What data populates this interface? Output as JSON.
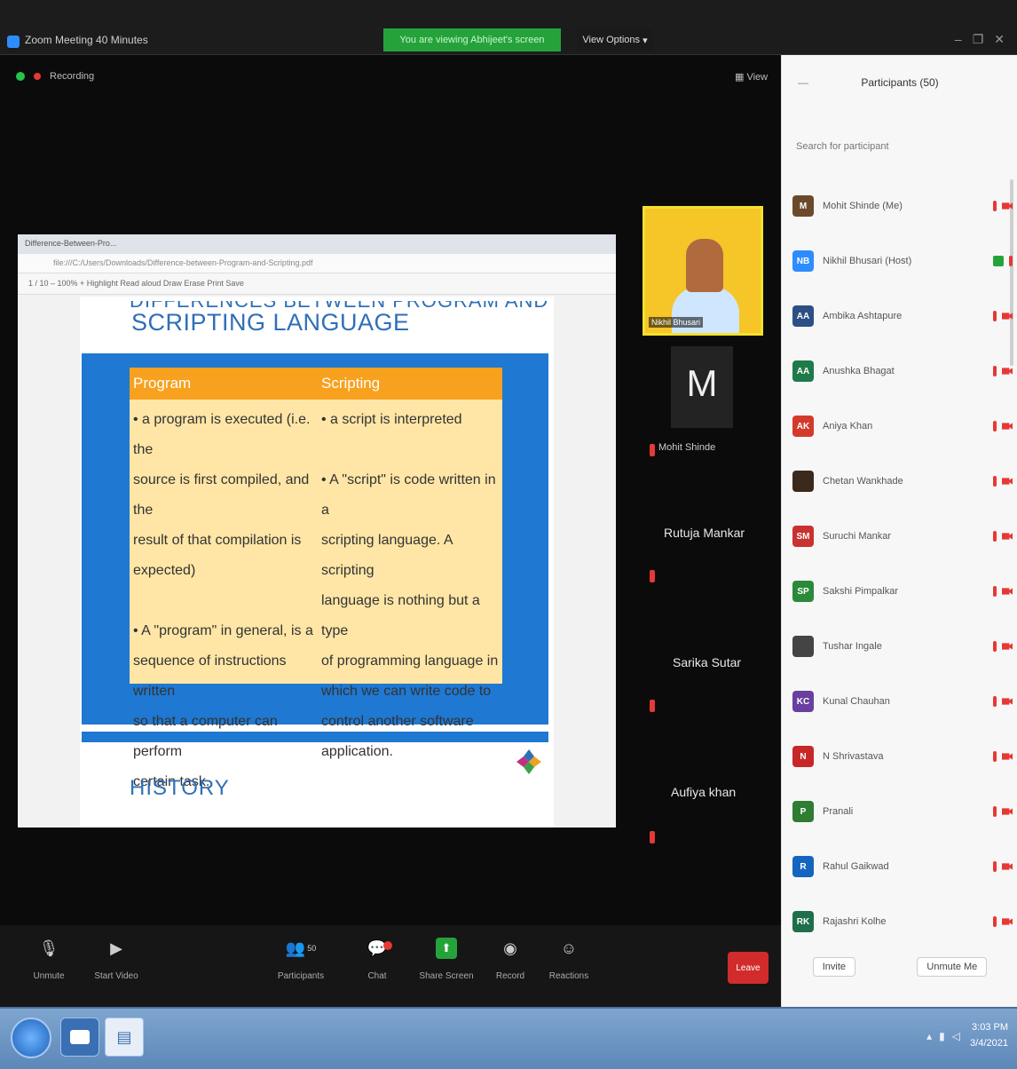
{
  "window": {
    "title": "Zoom Meeting 40 Minutes",
    "share_banner": "You are viewing Abhijeet's screen",
    "view_options": "View Options",
    "controls": [
      "–",
      "❐",
      "✕"
    ]
  },
  "meeting": {
    "recording_label": "Recording",
    "view_button": "View"
  },
  "browser": {
    "tab_label": "Difference-Between-Pro...",
    "address": "file:///C:/Users/Downloads/Difference-between-Program-and-Scripting.pdf",
    "pdf_toolbar": "1 / 10     –   100%   +     Highlight     Read aloud     Draw     Erase     Print     Save"
  },
  "slide": {
    "title_top": "DIFFERENCES BETWEEN PROGRAM AND",
    "title": "SCRIPTING LANGUAGE",
    "table": {
      "col1_header": "Program",
      "col2_header": "Scripting",
      "col1_lines": [
        "• a program is executed (i.e. the",
        "source is first compiled, and the",
        "result of that compilation is",
        "expected)",
        "",
        "• A \"program\" in general, is a",
        "sequence of instructions written",
        "so that a computer can perform",
        "certain task."
      ],
      "col2_lines": [
        "• a script is interpreted",
        "",
        "",
        "• A \"script\" is code written in a",
        "scripting language. A scripting",
        "language is nothing but a type",
        "of programming language in",
        "which we can write code to",
        "control another software",
        "application."
      ]
    },
    "next_section": "HISTORY"
  },
  "video_strip": {
    "speaker_name": "Nikhil Bhusari",
    "m_tile_letter": "M",
    "m_tile_name": "Mohit Shinde",
    "participants": [
      "Rutuja Mankar",
      "Sarika Sutar",
      "Aufiya khan"
    ]
  },
  "toolbar": {
    "unmute": "Unmute",
    "start_video": "Start Video",
    "participants": "Participants",
    "participants_count": "50",
    "chat": "Chat",
    "share_screen": "Share Screen",
    "record": "Record",
    "reactions": "Reactions",
    "leave": "Leave"
  },
  "participants_panel": {
    "title": "Participants (50)",
    "search_placeholder": "Search for participant",
    "people": [
      {
        "initials": "M",
        "name": "Mohit Shinde (Me)",
        "color": "#6b4a2b"
      },
      {
        "initials": "NB",
        "name": "Nikhil Bhusari (Host)",
        "color": "#2d8cff"
      },
      {
        "initials": "AA",
        "name": "Ambika Ashtapure",
        "color": "#2c4f86"
      },
      {
        "initials": "AA",
        "name": "Anushka Bhagat",
        "color": "#1f7a4a"
      },
      {
        "initials": "AK",
        "name": "Aniya Khan",
        "color": "#d23b2b"
      },
      {
        "initials": "",
        "name": "Chetan Wankhade",
        "color": "#3b2a1c"
      },
      {
        "initials": "SM",
        "name": "Suruchi Mankar",
        "color": "#c8322f"
      },
      {
        "initials": "SP",
        "name": "Sakshi Pimpalkar",
        "color": "#2a8a3a"
      },
      {
        "initials": "",
        "name": "Tushar Ingale",
        "color": "#444444"
      },
      {
        "initials": "KC",
        "name": "Kunal Chauhan",
        "color": "#6a3fa0"
      },
      {
        "initials": "N",
        "name": "N Shrivastava",
        "color": "#c62828"
      },
      {
        "initials": "P",
        "name": "Pranali",
        "color": "#2e7d32"
      },
      {
        "initials": "R",
        "name": "Rahul Gaikwad",
        "color": "#1565c0"
      },
      {
        "initials": "RK",
        "name": "Rajashri Kolhe",
        "color": "#1f6f4a"
      }
    ],
    "invite": "Invite",
    "unmute_me": "Unmute Me"
  },
  "taskbar": {
    "time": "3:03 PM",
    "date": "3/4/2021"
  }
}
